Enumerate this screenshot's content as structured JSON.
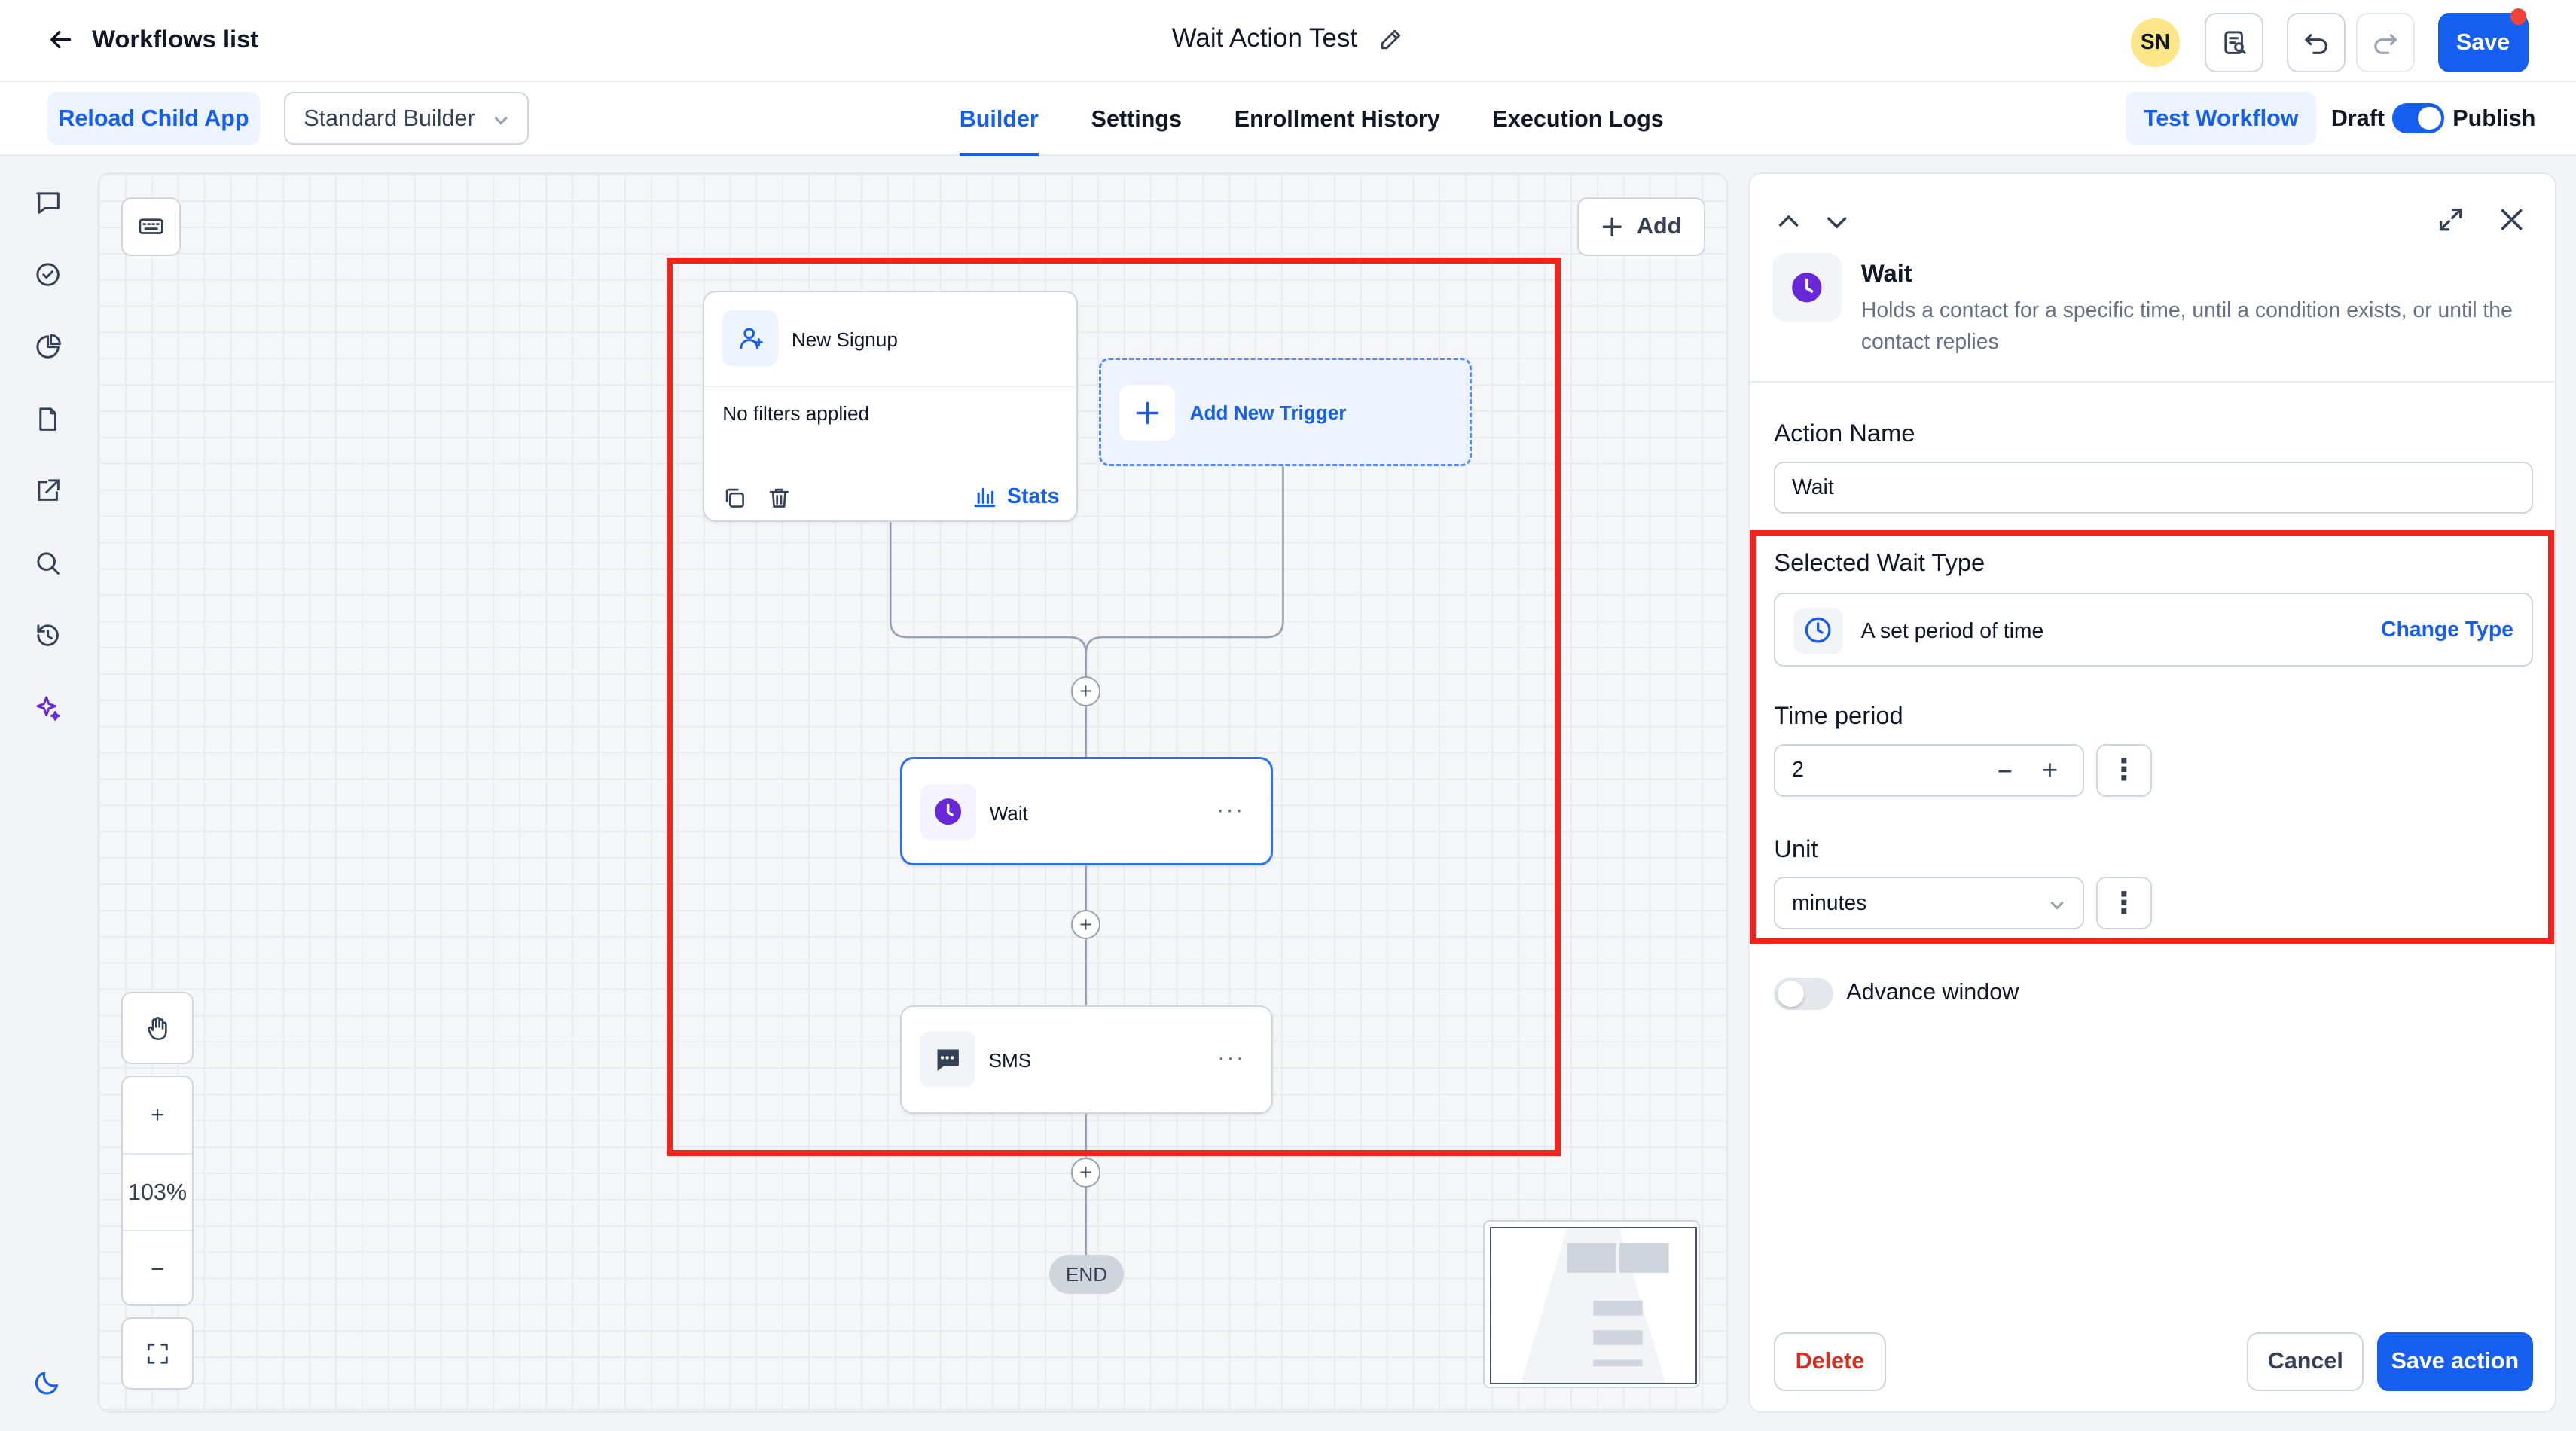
{
  "header": {
    "back_label": "Workflows list",
    "title": "Wait Action Test",
    "avatar_initials": "SN",
    "save_label": "Save"
  },
  "toolbar": {
    "reload_label": "Reload Child App",
    "builder_select_value": "Standard Builder",
    "tabs": [
      {
        "label": "Builder",
        "active": true
      },
      {
        "label": "Settings",
        "active": false
      },
      {
        "label": "Enrollment History",
        "active": false
      },
      {
        "label": "Execution Logs",
        "active": false
      }
    ],
    "test_workflow_label": "Test Workflow",
    "draft_label": "Draft",
    "publish_label": "Publish",
    "publish_toggle_on": true
  },
  "sidebar": {
    "icons": [
      "chat-icon",
      "check-circle-icon",
      "pie-chart-icon",
      "document-icon",
      "external-link-icon",
      "search-icon",
      "history-icon",
      "sparkle-icon",
      "moon-icon"
    ]
  },
  "canvas": {
    "add_label": "Add",
    "trigger": {
      "name": "New Signup",
      "filters_text": "No filters applied",
      "stats_label": "Stats"
    },
    "add_trigger_label": "Add New Trigger",
    "nodes": [
      {
        "label": "Wait",
        "menu": "···"
      },
      {
        "label": "SMS",
        "menu": "···"
      }
    ],
    "plus_symbol": "+",
    "end_label": "END",
    "zoom_level": "103%",
    "zoom_in": "+",
    "zoom_out": "−"
  },
  "panel": {
    "action_title": "Wait",
    "action_description": "Holds a contact for a specific time, until a condition exists, or until the contact replies",
    "action_name_label": "Action Name",
    "action_name_value": "Wait",
    "wait_type_label": "Selected Wait Type",
    "wait_type_value": "A set period of time",
    "change_type_label": "Change Type",
    "time_period_label": "Time period",
    "time_period_value": "2",
    "stepper_minus": "−",
    "stepper_plus": "+",
    "unit_label": "Unit",
    "unit_value": "minutes",
    "kebab": "⋮",
    "advance_window_label": "Advance window",
    "advance_window_on": false,
    "delete_label": "Delete",
    "cancel_label": "Cancel",
    "save_action_label": "Save action"
  },
  "colors": {
    "primary": "#155eef",
    "highlight_box": "#f0231d",
    "danger": "#d92d20",
    "wait_accent": "#6927da"
  }
}
